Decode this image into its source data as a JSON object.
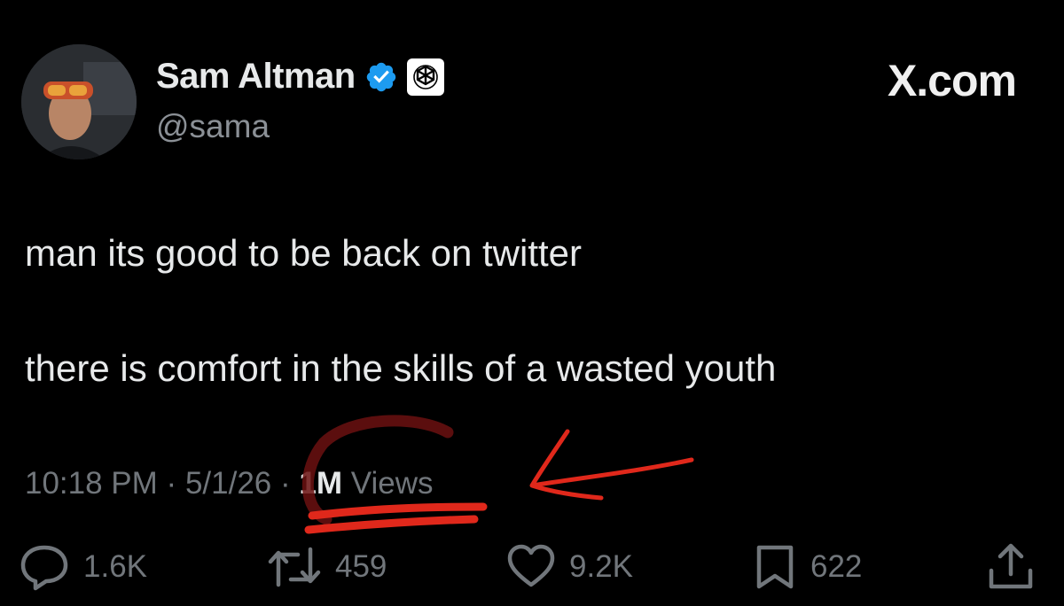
{
  "brand": {
    "text": "X.com"
  },
  "author": {
    "display_name": "Sam Altman",
    "handle": "@sama"
  },
  "tweet": {
    "line1": "man its good to be back on twitter",
    "line2": "there is comfort in the skills of a wasted youth"
  },
  "meta": {
    "time": "10:18 PM",
    "separator": "·",
    "date": "5/1/26",
    "views_count": "1M",
    "views_label": "Views"
  },
  "actions": {
    "replies": "1.6K",
    "reposts": "459",
    "likes": "9.2K",
    "bookmarks": "622"
  },
  "colors": {
    "background": "#000000",
    "text": "#e7e9ea",
    "muted": "#71767b",
    "verified": "#1d9bf0",
    "annotation": "#e0281b"
  }
}
